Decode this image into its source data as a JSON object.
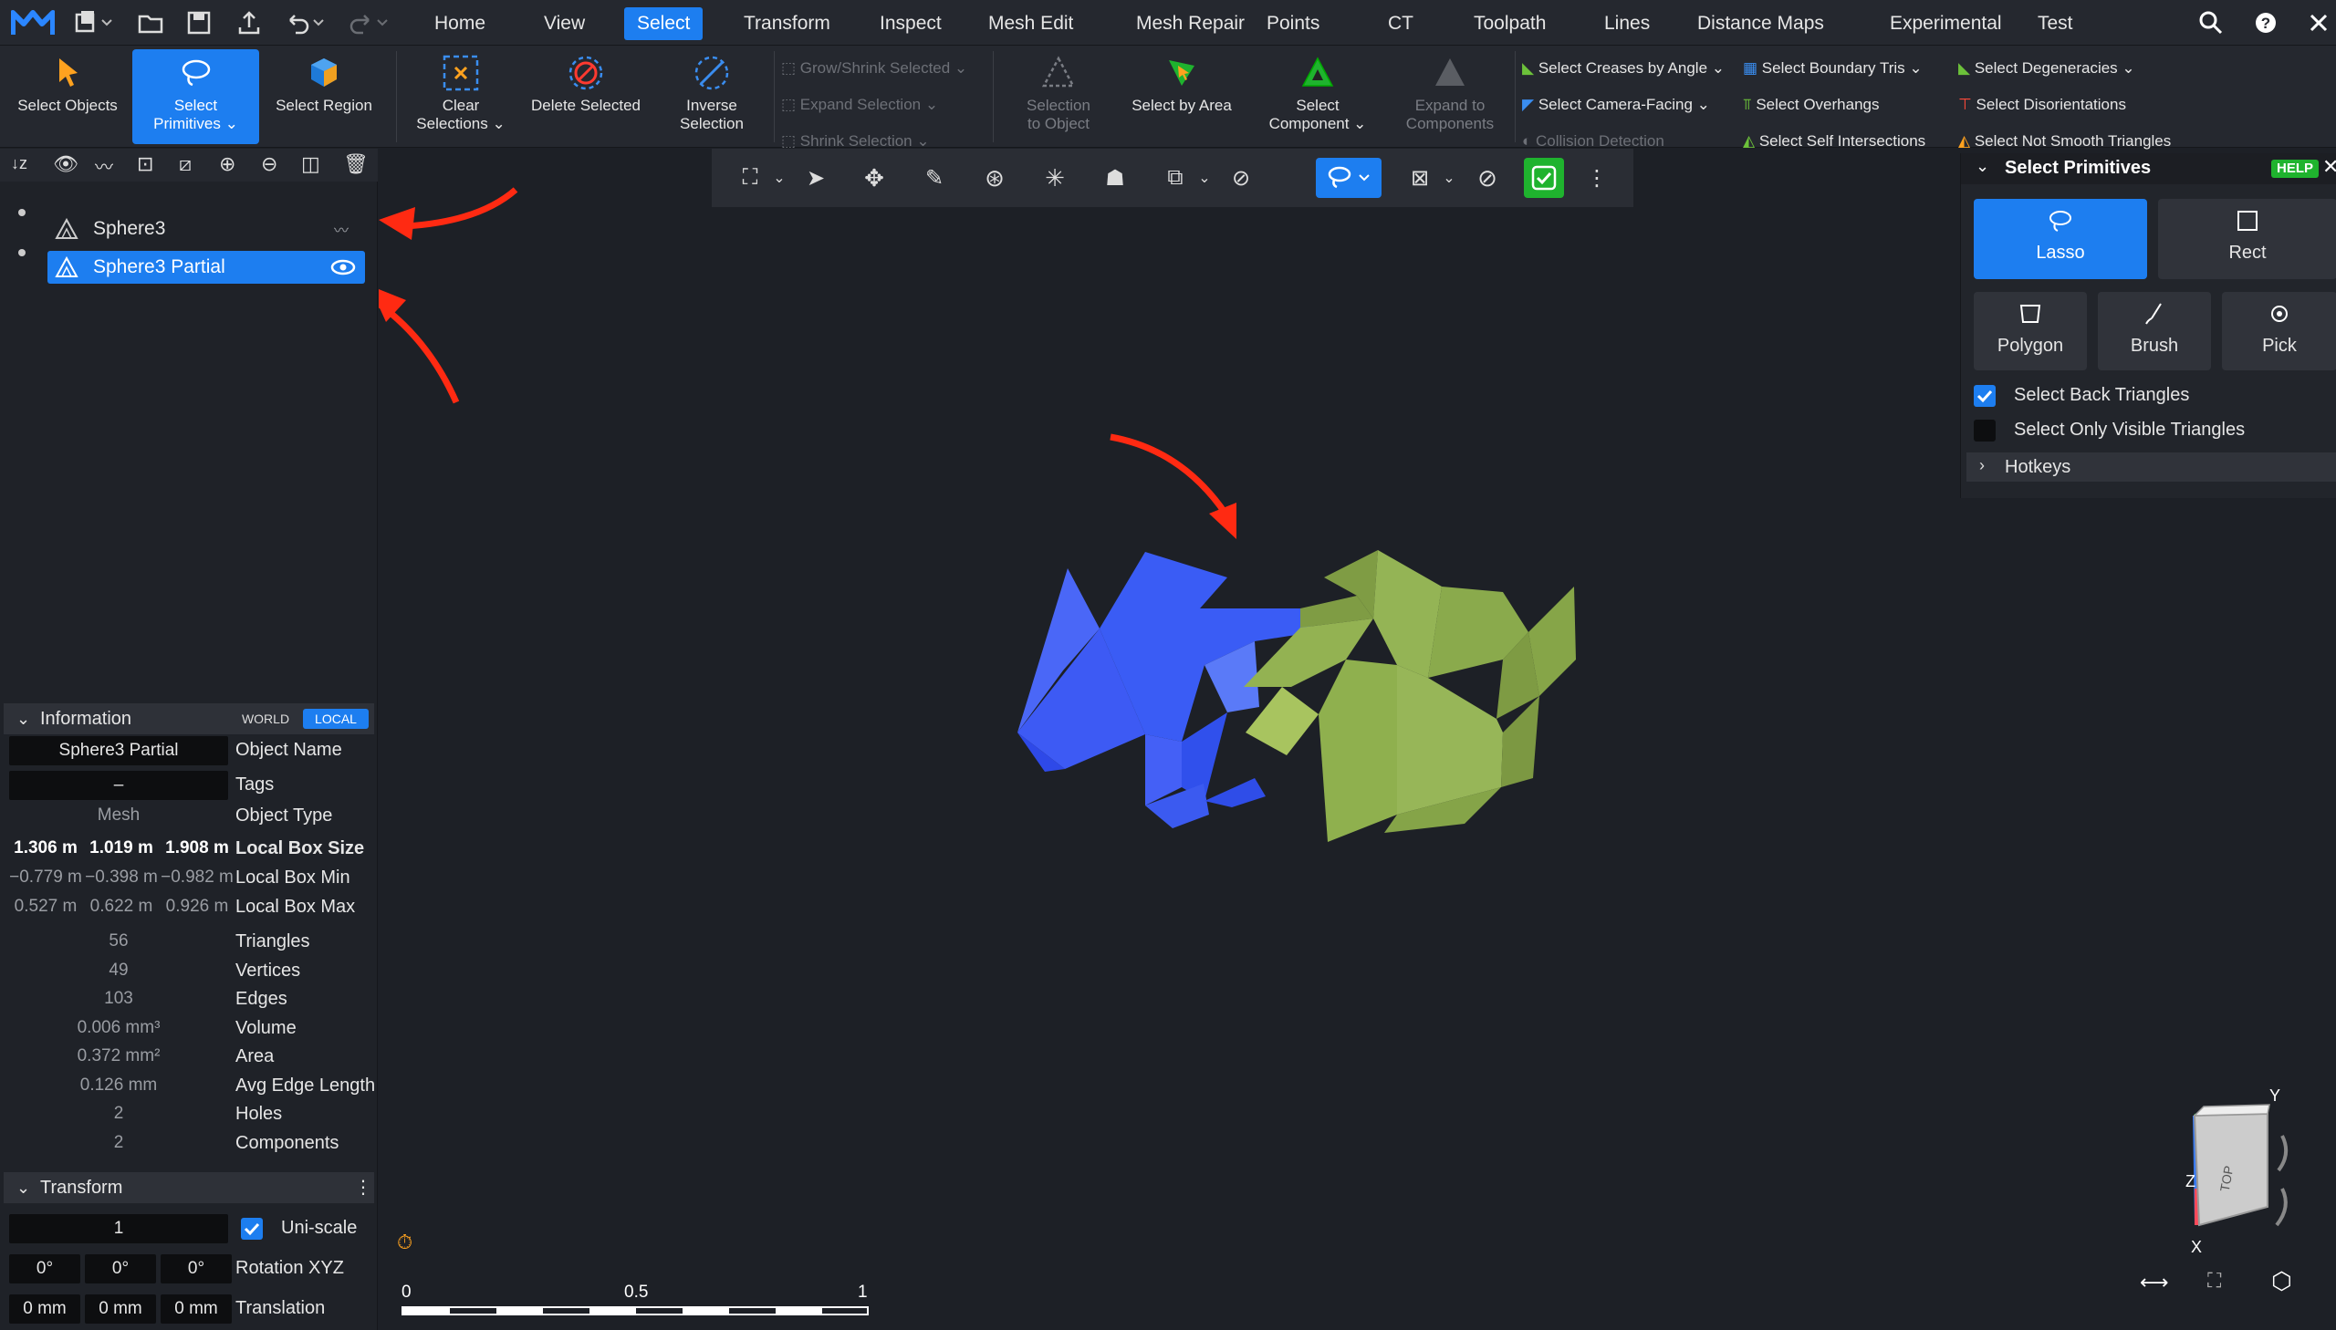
{
  "tabs": [
    "Home",
    "View",
    "Select",
    "Transform",
    "Inspect",
    "Mesh Edit",
    "Mesh Repair",
    "Points",
    "CT",
    "Toolpath",
    "Lines",
    "Distance Maps",
    "Experimental",
    "Test"
  ],
  "active_tab": "Select",
  "ribbon": {
    "select_objects": "Select Objects",
    "select_primitives": [
      "Select",
      "Primitives"
    ],
    "select_region": "Select Region",
    "clear_selections": [
      "Clear",
      "Selections"
    ],
    "delete_selected": "Delete Selected",
    "inverse_selection": [
      "Inverse",
      "Selection"
    ],
    "grow_shrink": "Grow/Shrink Selected",
    "expand_selection": "Expand Selection",
    "shrink_selection": "Shrink Selection",
    "selection_to_object": [
      "Selection",
      "to Object"
    ],
    "select_by_area": "Select by Area",
    "select_component": [
      "Select",
      "Component"
    ],
    "expand_to_components": [
      "Expand to",
      "Components"
    ],
    "select_creases": "Select Creases by Angle",
    "select_camera_facing": "Select Camera-Facing",
    "collision_detection": "Collision Detection",
    "select_boundary_tris": "Select Boundary Tris",
    "select_overhangs": "Select Overhangs",
    "select_self_intersections": "Select Self Intersections",
    "select_degeneracies": "Select Degeneracies",
    "select_disorientations": "Select Disorientations",
    "select_not_smooth": "Select Not Smooth Triangles"
  },
  "objects": [
    {
      "name": "Sphere3",
      "visible": false
    },
    {
      "name": "Sphere3 Partial",
      "visible": true,
      "selected": true
    }
  ],
  "info": {
    "header": "Information",
    "world": "WORLD",
    "local": "LOCAL",
    "object_name_value": "Sphere3 Partial",
    "object_name_label": "Object Name",
    "tags_value": "–",
    "tags_label": "Tags",
    "type_value": "Mesh",
    "type_label": "Object Type",
    "box_size": [
      "1.306 m",
      "1.019 m",
      "1.908 m"
    ],
    "box_size_label": "Local Box Size",
    "box_min": [
      "−0.779 m",
      "−0.398 m",
      "−0.982 m"
    ],
    "box_min_label": "Local Box Min",
    "box_max": [
      "0.527 m",
      "0.622 m",
      "0.926 m"
    ],
    "box_max_label": "Local Box Max",
    "stats": [
      {
        "value": "56",
        "label": "Triangles"
      },
      {
        "value": "49",
        "label": "Vertices"
      },
      {
        "value": "103",
        "label": "Edges"
      },
      {
        "value": "0.006 mm³",
        "label": "Volume"
      },
      {
        "value": "0.372 mm²",
        "label": "Area"
      },
      {
        "value": "0.126 mm",
        "label": "Avg Edge Length"
      },
      {
        "value": "2",
        "label": "Holes"
      },
      {
        "value": "2",
        "label": "Components"
      }
    ]
  },
  "transform": {
    "header": "Transform",
    "scale": "1",
    "uniscale_label": "Uni-scale",
    "rotation": [
      "0°",
      "0°",
      "0°"
    ],
    "rotation_label": "Rotation XYZ",
    "translation": [
      "0 mm",
      "0 mm",
      "0 mm"
    ],
    "translation_label": "Translation"
  },
  "panel": {
    "title": "Select Primitives",
    "help": "HELP",
    "modes": [
      "Lasso",
      "Rect",
      "Polygon",
      "Brush",
      "Pick"
    ],
    "back_triangles": "Select Back Triangles",
    "only_visible": "Select Only Visible Triangles",
    "hotkeys": "Hotkeys"
  },
  "scale_bar": {
    "ticks": [
      "0",
      "0.5",
      "1"
    ]
  },
  "gizmo": {
    "y": "Y",
    "z": "Z",
    "x": "X",
    "top": "TOP"
  },
  "colors": {
    "accent": "#1d7ef0",
    "blue_mesh": "#3a5cf5",
    "green_mesh": "#8fb04e",
    "arrow": "#ff2a12",
    "ok": "#1fb32e"
  }
}
